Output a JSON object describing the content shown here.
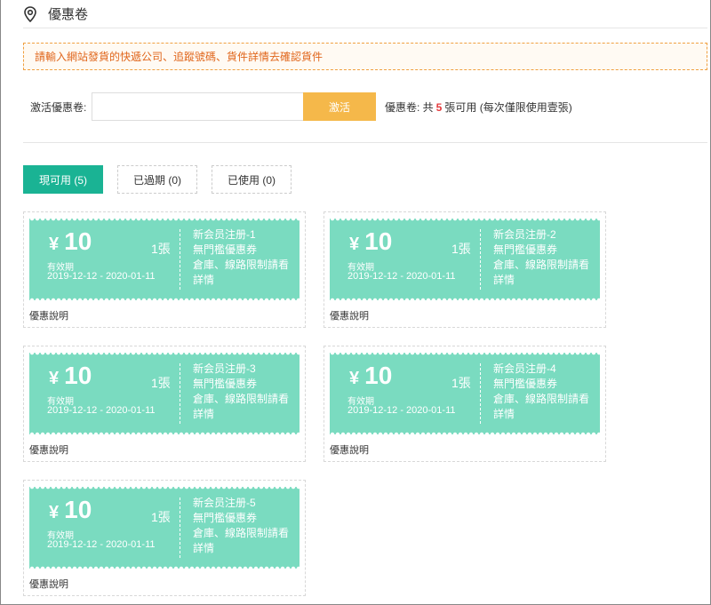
{
  "header": {
    "title": "優惠卷",
    "icon": "location-pin-icon"
  },
  "notice": {
    "text": "請輸入網站發貨的快遞公司、追蹤號碼、貨件詳情去確認貨件"
  },
  "activate": {
    "label": "激活優惠卷:",
    "input_value": "",
    "placeholder": "",
    "button_label": "激活",
    "summary_prefix": "優惠卷: 共",
    "summary_count": "5",
    "summary_suffix": "張可用 (每次僅限使用壹張)"
  },
  "tabs": [
    {
      "label": "現可用 (5)",
      "active": true
    },
    {
      "label": "已過期 (0)",
      "active": false
    },
    {
      "label": "已使用 (0)",
      "active": false
    }
  ],
  "coupons": [
    {
      "currency": "¥",
      "amount": "10",
      "qty": "1張",
      "valid_label": "有效期",
      "valid_range": "2019-12-12 - 2020-01-11",
      "name": "新会员注册-1",
      "line2": "無門檻優惠券",
      "line3": "倉庫、線路限制請看詳情",
      "desc": "優惠說明"
    },
    {
      "currency": "¥",
      "amount": "10",
      "qty": "1張",
      "valid_label": "有效期",
      "valid_range": "2019-12-12 - 2020-01-11",
      "name": "新会员注册-2",
      "line2": "無門檻優惠券",
      "line3": "倉庫、線路限制請看詳情",
      "desc": "優惠說明"
    },
    {
      "currency": "¥",
      "amount": "10",
      "qty": "1張",
      "valid_label": "有效期",
      "valid_range": "2019-12-12 - 2020-01-11",
      "name": "新会员注册-3",
      "line2": "無門檻優惠券",
      "line3": "倉庫、線路限制請看詳情",
      "desc": "優惠說明"
    },
    {
      "currency": "¥",
      "amount": "10",
      "qty": "1張",
      "valid_label": "有效期",
      "valid_range": "2019-12-12 - 2020-01-11",
      "name": "新会员注册-4",
      "line2": "無門檻優惠券",
      "line3": "倉庫、線路限制請看詳情",
      "desc": "優惠說明"
    },
    {
      "currency": "¥",
      "amount": "10",
      "qty": "1張",
      "valid_label": "有效期",
      "valid_range": "2019-12-12 - 2020-01-11",
      "name": "新会员注册-5",
      "line2": "無門檻優惠券",
      "line3": "倉庫、線路限制請看詳情",
      "desc": "優惠說明"
    }
  ],
  "colors": {
    "accent_green": "#1ab394",
    "ticket_green": "#7adbc0",
    "activate_button": "#f5b84a",
    "notice_text": "#e0661c",
    "count_red": "#e4393c"
  }
}
